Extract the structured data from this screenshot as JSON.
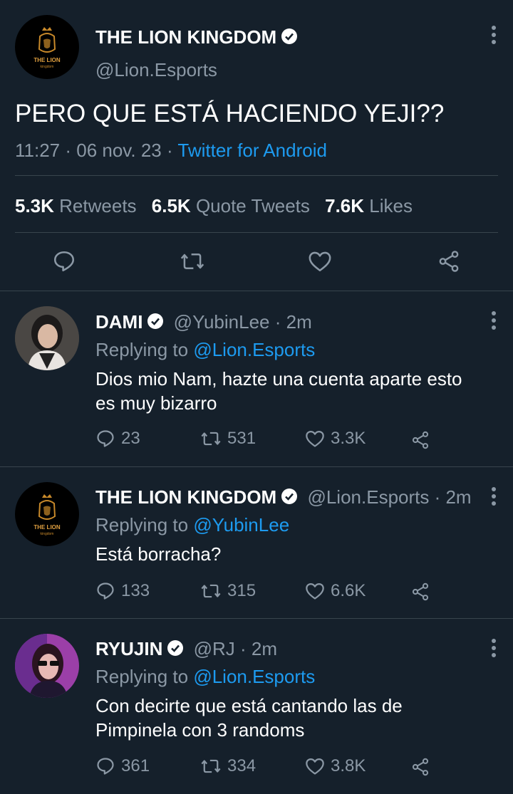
{
  "main_tweet": {
    "display_name": "THE LION KINGDOM",
    "handle": "@Lion.Esports",
    "avatar_text_top": "THE LION",
    "avatar_text_bottom": "kingdom",
    "text": "PERO QUE ESTÁ HACIENDO YEJI??",
    "time": "11:27 · 06 nov. 23 ·",
    "source": "Twitter for Android",
    "retweets_count": "5.3K",
    "retweets_label": "Retweets",
    "quotes_count": "6.5K",
    "quotes_label": "Quote Tweets",
    "likes_count": "7.6K",
    "likes_label": "Likes"
  },
  "replies": [
    {
      "display_name": "DAMI",
      "handle_time": "@YubinLee · 2m",
      "replying_label": "Replying to",
      "replying_to": "@Lion.Esports",
      "text_line1": "Dios mio Nam, hazte una cuenta aparte esto",
      "text_line2": "es muy bizarro",
      "replies": "23",
      "retweets": "531",
      "likes": "3.3K"
    },
    {
      "display_name": "THE LION KINGDOM",
      "handle_time": "@Lion.Esports · 2m",
      "replying_label": "Replying to",
      "replying_to": "@YubinLee",
      "text_line1": "Está borracha?",
      "replies": "133",
      "retweets": "315",
      "likes": "6.6K"
    },
    {
      "display_name": "RYUJIN",
      "handle_time": "@RJ · 2m",
      "replying_label": "Replying to",
      "replying_to": "@Lion.Esports",
      "text_line1": "Con decirte que está cantando las de",
      "text_line2": "Pimpinela con 3 randoms",
      "replies": "361",
      "retweets": "334",
      "likes": "3.8K"
    }
  ],
  "colors": {
    "background": "#15202b",
    "link": "#1d9bf0",
    "muted": "#8b98a5",
    "divider": "#38444d"
  }
}
